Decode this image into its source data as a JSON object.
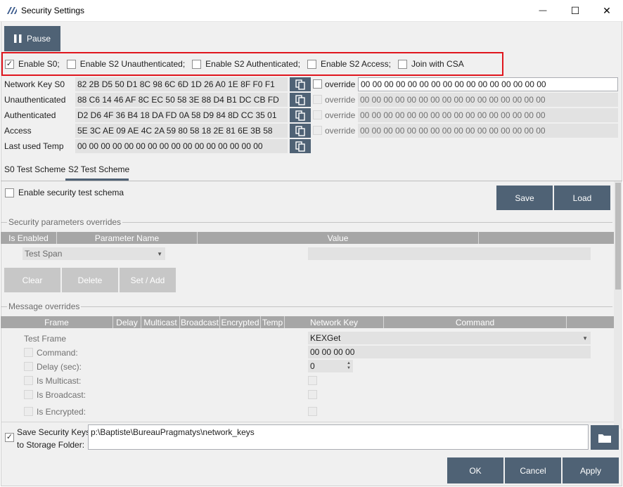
{
  "window": {
    "title": "Security Settings",
    "minimize_glyph": "—",
    "maximize_glyph": "☐",
    "close_glyph": "✕"
  },
  "toolbar": {
    "pause_label": "Pause"
  },
  "enable_options": [
    {
      "label": "Enable S0;",
      "checked": true
    },
    {
      "label": "Enable S2 Unauthenticated;",
      "checked": false
    },
    {
      "label": "Enable S2 Authenticated;",
      "checked": false
    },
    {
      "label": "Enable S2 Access;",
      "checked": false
    },
    {
      "label": "Join with CSA",
      "checked": false
    }
  ],
  "highlight_color": "#e0161e",
  "keys": [
    {
      "label": "Network Key S0",
      "value": "82 2B D5 50 D1 8C 98 6C 6D 1D 26 A0 1E 8F F0 F1",
      "override_label": "override",
      "override_value": "00 00 00 00 00 00 00 00 00 00 00 00 00 00 00 00"
    },
    {
      "label": "Unauthenticated",
      "value": "88 C6 14 46 AF 8C EC 50 58 3E 88 D4 B1 DC CB FD",
      "override_label": "override",
      "override_value": "00 00 00 00 00 00 00 00 00 00 00 00 00 00 00 00"
    },
    {
      "label": "Authenticated",
      "value": "D2 D6 4F 36 B4 18 DA FD 0A 58 D9 84 8D CC 35 01",
      "override_label": "override",
      "override_value": "00 00 00 00 00 00 00 00 00 00 00 00 00 00 00 00"
    },
    {
      "label": "Access",
      "value": "5E 3C AE 09 AE 4C 2A 59 80 58 18 2E 81 6E 3B 58",
      "override_label": "override",
      "override_value": "00 00 00 00 00 00 00 00 00 00 00 00 00 00 00 00"
    },
    {
      "label": "Last used Temp",
      "value": "00 00 00 00 00 00 00 00 00 00 00 00 00 00 00 00"
    }
  ],
  "tabs": [
    {
      "label": "S0 Test Scheme",
      "active": false
    },
    {
      "label": "S2 Test Scheme",
      "active": true
    }
  ],
  "schema": {
    "enable_label": "Enable security test schema",
    "save_label": "Save",
    "load_label": "Load"
  },
  "security_params": {
    "section_title": "Security parameters overrides",
    "columns": [
      "Is Enabled",
      "Parameter Name",
      "Value"
    ],
    "selected_param": "Test Span",
    "value": "",
    "buttons": [
      "Clear",
      "Delete",
      "Set / Add"
    ]
  },
  "message_overrides": {
    "section_title": "Message overrides",
    "columns": [
      "Frame",
      "Delay",
      "Multicast",
      "Broadcast",
      "Encrypted",
      "Temp",
      "Network Key",
      "Command"
    ],
    "test_frame_label": "Test Frame",
    "test_frame_value": "KEXGet",
    "fields": [
      {
        "label": "Command:",
        "value": "00 00 00 00"
      },
      {
        "label": "Delay (sec):",
        "value": "0"
      },
      {
        "label": "Is Multicast:"
      },
      {
        "label": "Is Broadcast:"
      },
      {
        "label": "Is Encrypted:"
      }
    ]
  },
  "storage": {
    "label_line1": "Save Security Keys",
    "label_line2": "to Storage Folder:",
    "checked": true,
    "path": "p:\\Baptiste\\BureauPragmatys\\network_keys"
  },
  "footer": {
    "ok_label": "OK",
    "cancel_label": "Cancel",
    "apply_label": "Apply"
  },
  "colors": {
    "accent": "#4f6275",
    "disabled_button": "#c7c7c7",
    "table_header": "#a6a6a6",
    "field_bg": "#e2e2e2"
  }
}
